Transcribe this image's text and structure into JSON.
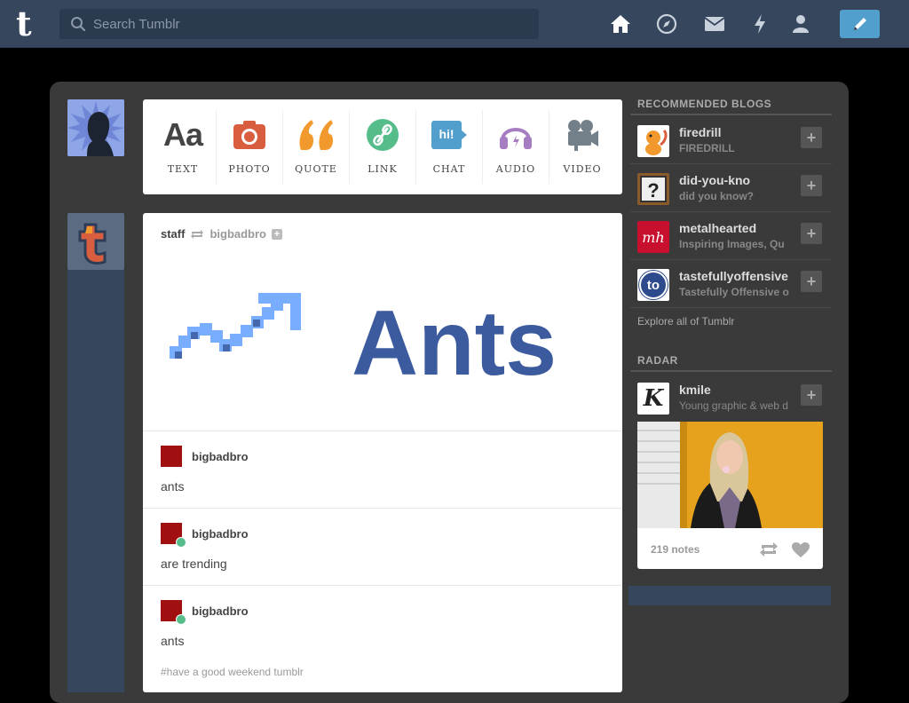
{
  "header": {
    "logo": "t",
    "search_placeholder": "Search Tumblr",
    "nav": [
      "home-icon",
      "explore-icon",
      "inbox-icon",
      "activity-icon",
      "account-icon"
    ],
    "compose_icon": "pencil-icon"
  },
  "post_types": [
    {
      "label": "TEXT",
      "icon": "text-icon",
      "color": "#444444",
      "glyph": "Aa"
    },
    {
      "label": "PHOTO",
      "icon": "camera-icon",
      "color": "#d95e40"
    },
    {
      "label": "QUOTE",
      "icon": "quote-icon",
      "color": "#f2992e"
    },
    {
      "label": "LINK",
      "icon": "link-icon",
      "color": "#56bc8a"
    },
    {
      "label": "CHAT",
      "icon": "chat-icon",
      "color": "#529ecc",
      "glyph": "hi!"
    },
    {
      "label": "AUDIO",
      "icon": "headphones-icon",
      "color": "#a77dc2"
    },
    {
      "label": "VIDEO",
      "icon": "video-camera-icon",
      "color": "#748089"
    }
  ],
  "post": {
    "author": "staff",
    "reblogged_from": "bigbadbro",
    "image_text": "Ants",
    "thread": [
      {
        "name": "bigbadbro",
        "body": "ants"
      },
      {
        "name": "bigbadbro",
        "body": "are trending"
      },
      {
        "name": "bigbadbro",
        "body": "ants"
      }
    ],
    "tags": "#have a good weekend tumblr"
  },
  "sidebar": {
    "recommended_title": "RECOMMENDED BLOGS",
    "recommended": [
      {
        "name": "firedrill",
        "desc": "FIREDRILL"
      },
      {
        "name": "did-you-kno",
        "desc": "did you know?"
      },
      {
        "name": "metalhearted",
        "desc": "Inspiring Images, Qu",
        "avatar_text": "mh"
      },
      {
        "name": "tastefullyoffensive",
        "desc": "Tastefully Offensive o",
        "avatar_text": "to"
      }
    ],
    "explore": "Explore all of Tumblr",
    "radar_title": "RADAR",
    "radar": {
      "name": "kmile",
      "desc": "Young graphic & web d",
      "avatar_text": "K",
      "notes": "219 notes"
    }
  },
  "colors": {
    "header": "#36465d",
    "panel": "#3a3a3a",
    "accent": "#529ecc"
  }
}
